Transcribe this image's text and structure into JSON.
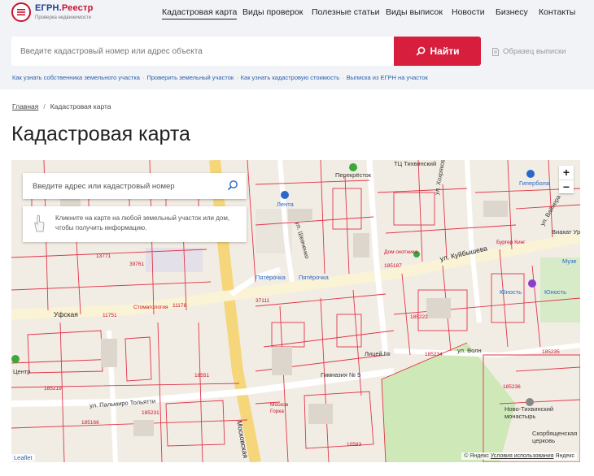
{
  "header": {
    "logo": {
      "title_main": "ЕГРН.",
      "title_accent": "Реестр",
      "subtitle": "Проверка недвижимости"
    },
    "nav": [
      {
        "label": "Кадастровая карта",
        "active": true
      },
      {
        "label": "Виды проверок"
      },
      {
        "label": "Полезные статьи"
      },
      {
        "label": "Виды выписок"
      },
      {
        "label": "Новости"
      },
      {
        "label": "Бизнесу"
      },
      {
        "label": "Контакты"
      }
    ],
    "search": {
      "placeholder": "Введите кадастровый номер или адрес объекта",
      "button": "Найти"
    },
    "sample_link": "Образец выписки",
    "quick_links": [
      "Как узнать собственника земельного участка",
      "Проверить земельный участок",
      "Как узнать кадастровую стоимость",
      "Выписка из ЕГРН на участок"
    ]
  },
  "breadcrumb": {
    "home": "Главная",
    "current": "Кадастровая карта"
  },
  "page_title": "Кадастровая карта",
  "map": {
    "search_placeholder": "Введите адрес или кадастровый номер",
    "hint": "Кликните на карте на любой земельный участок или дом, чтобы получить информацию.",
    "zoom_in": "+",
    "zoom_out": "−",
    "attribution": {
      "provider": "© Яндекс",
      "terms": "Условия использования",
      "brand": "Яндекс"
    },
    "leaflet": "Leaflet",
    "labels": {
      "kuibysheva": "ул. Куйбышева",
      "ufskaya": "Уфская",
      "moskovskaya": "Московская",
      "palmiro": "ул. Пальмиро Тольятти",
      "shevchenko": "ул. Шевченко",
      "khokhryakova": "ул. Хохрякова",
      "volna": "ул. Волн",
      "pyaterochka1": "Пятёрочка",
      "pyaterochka2": "Пятёрочка",
      "lenta": "Лента",
      "perekryostok": "Перекрёсток",
      "tts": "ТЦ Тихвинский",
      "giperbola": "Гипербола",
      "stomatologiya": "Стоматология",
      "licey": "Лицей №",
      "gimnaziya": "Гимназия № 5",
      "novo_tikhvinsky": "Ново-Тихвинский монастырь",
      "yunost1": "Юность",
      "yunost2": "Юность",
      "muzej": "Музе",
      "tsentr": "Центр",
      "burger": "Бургер Кинг",
      "dom_ohotnika": "Дом охотника",
      "vainera": "ул. Вайнера",
      "viakhat": "Виахат Уро",
      "skorb": "Скорбященская церковь",
      "moskovskaya_gorka": "Москов Горка"
    },
    "parcel_ids": [
      "185187",
      "185234",
      "185235",
      "185166",
      "185219",
      "185236",
      "185231",
      "185222",
      "11751",
      "11178",
      "13771",
      "10583",
      "37111",
      "18551",
      "39761"
    ]
  },
  "colors": {
    "brand_red": "#d71f3d",
    "link_blue": "#2b5fae",
    "parcel_red": "#e03548"
  }
}
